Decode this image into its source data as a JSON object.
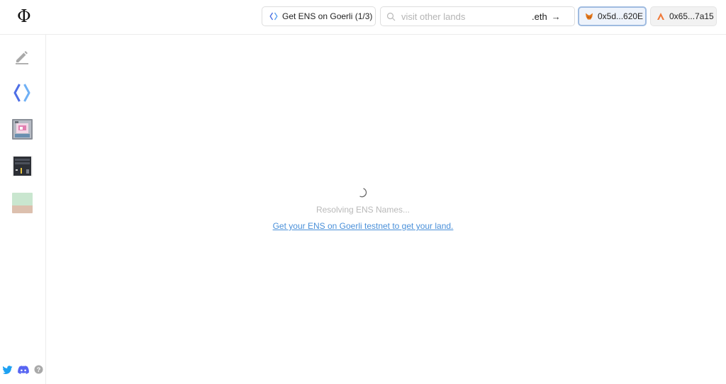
{
  "header": {
    "logo": "Φ",
    "ens_task_label": "Get ENS on Goerli (1/3)",
    "search": {
      "placeholder": "visit other lands",
      "suffix": ".eth",
      "arrow": "→"
    },
    "wallet_label": "0x5d...620E",
    "account_label": "0x65...7a15"
  },
  "sidebar": {
    "items": [
      {
        "name": "edit",
        "icon": "pencil-icon"
      },
      {
        "name": "ens",
        "icon": "ens-logo-icon"
      },
      {
        "name": "land-thumbnail-1",
        "icon": "land-thumbnail"
      },
      {
        "name": "land-thumbnail-2",
        "icon": "land-thumbnail"
      },
      {
        "name": "land-thumbnail-3",
        "icon": "land-thumbnail"
      }
    ],
    "social": [
      "twitter-icon",
      "discord-icon",
      "help-icon"
    ]
  },
  "main": {
    "status_text": "Resolving ENS Names...",
    "cta_link": "Get your ENS on Goerli testnet to get your land."
  },
  "colors": {
    "accent": "#4a90d9",
    "wallet_border": "#9fbbe0",
    "status_text": "#b9b9b9",
    "twitter": "#1da1f2",
    "discord": "#5865f2"
  }
}
